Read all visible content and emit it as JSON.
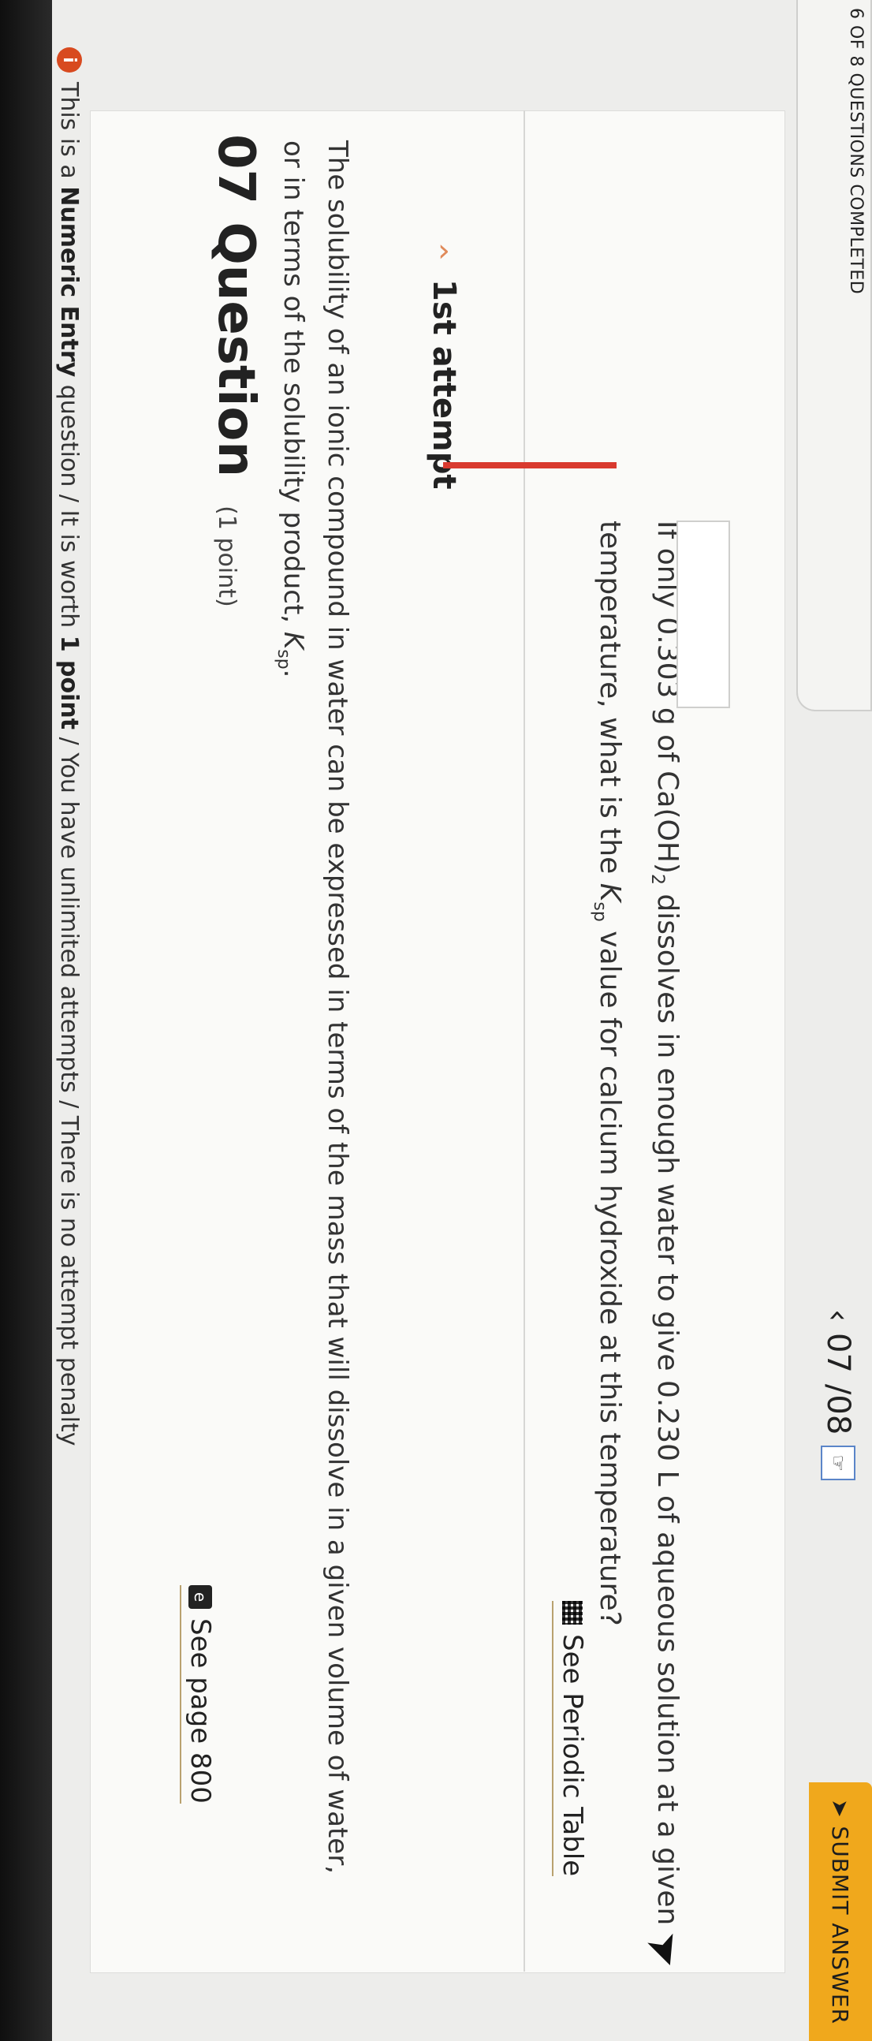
{
  "banner": {
    "icon": "i",
    "prefix": "This is a ",
    "type": "Numeric Entry",
    "middle": " question / It is worth ",
    "worth": "1 point",
    "suffix": " / You have unlimited attempts / There is no attempt penalty"
  },
  "progress": {
    "label": "6 OF 8 QUESTIONS COMPLETED"
  },
  "question": {
    "number": "07",
    "title": "Question",
    "points": "(1 point)",
    "stem": "The solubility of an ionic compound in water can be expressed in terms of the mass that will dissolve in a given volume of water, or in terms of the solubility product, ",
    "ksp_symbol": "K",
    "ksp_sub": "sp",
    "stem_end": ".",
    "see_page": "See page 800"
  },
  "attempt": {
    "label": "1st attempt",
    "prompt_start": "If only 0.303 g of Ca(OH)",
    "formula_sub": "2",
    "prompt_end": " dissolves in enough water to give 0.230 L of aqueous solution at a given temperature, what is the ",
    "ksp_symbol": "K",
    "ksp_sub": "sp",
    "prompt_tail": " value for calcium hydroxide at this temperature?",
    "periodic_link": "See Periodic Table",
    "answer_value": ""
  },
  "nav": {
    "current": "07",
    "total": "/08"
  },
  "submit": {
    "label": "SUBMIT ANSWER"
  },
  "colors": {
    "accent": "#f0a81c",
    "error_bar": "#d93a2f",
    "info": "#d84a1f"
  }
}
